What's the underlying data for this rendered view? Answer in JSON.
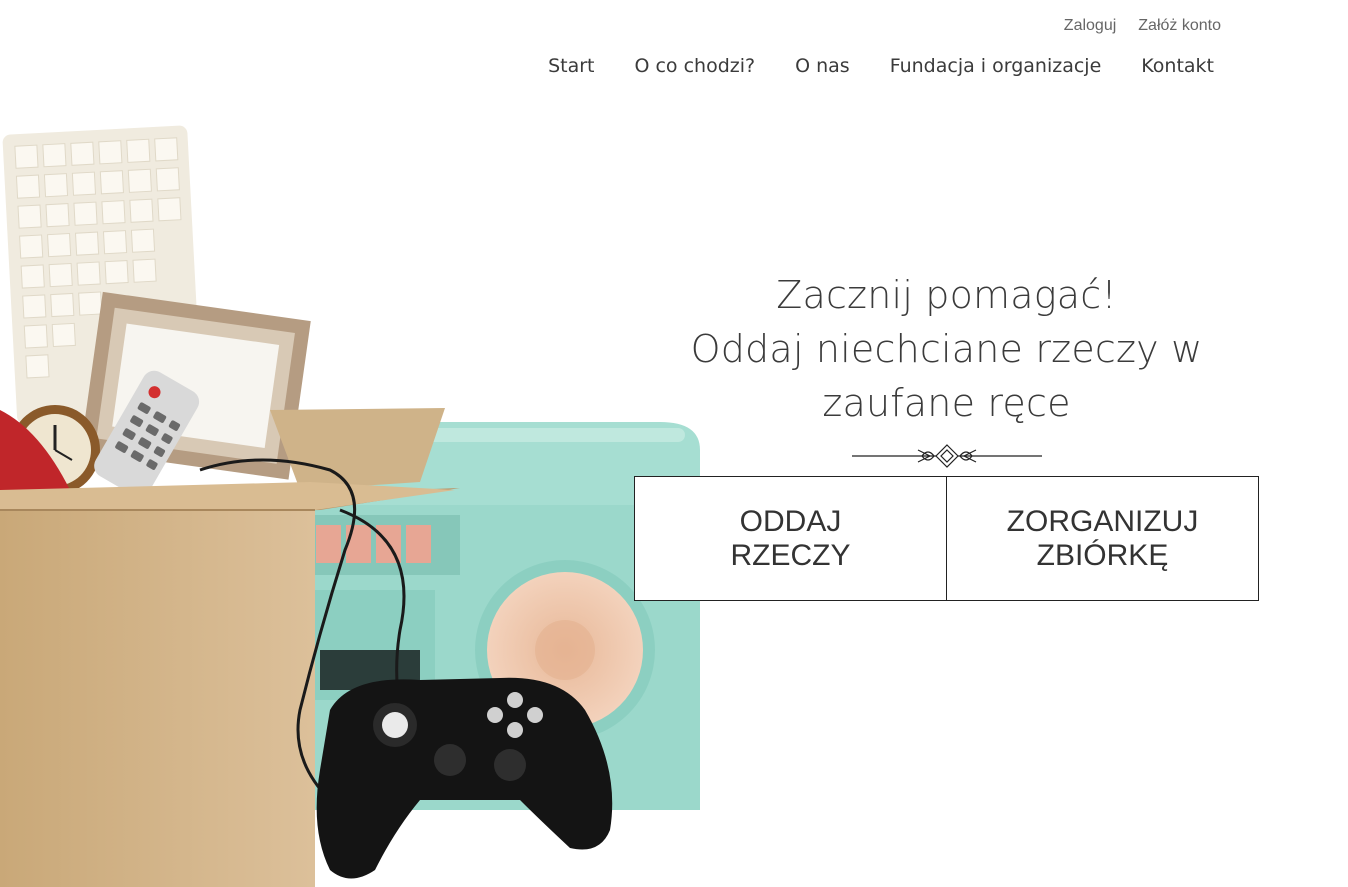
{
  "header": {
    "auth": {
      "login": "Zaloguj",
      "register": "Załóż konto"
    },
    "nav": [
      {
        "label": "Start"
      },
      {
        "label": "O co chodzi?"
      },
      {
        "label": "O nas"
      },
      {
        "label": "Fundacja i organizacje"
      },
      {
        "label": "Kontakt"
      }
    ]
  },
  "hero": {
    "title_line1": "Zacznij pomagać!",
    "title_line2": "Oddaj niechciane rzeczy w",
    "title_line3": "zaufane ręce",
    "buttons": {
      "give": "ODDAJ\nRZECZY",
      "organize": "ZORGANIZUJ\nZBIÓRKĘ"
    }
  },
  "colors": {
    "text": "#3b3b3b",
    "box": "#d2b48c",
    "radio": "#9fdcd0",
    "speaker": "#efc9ae"
  }
}
